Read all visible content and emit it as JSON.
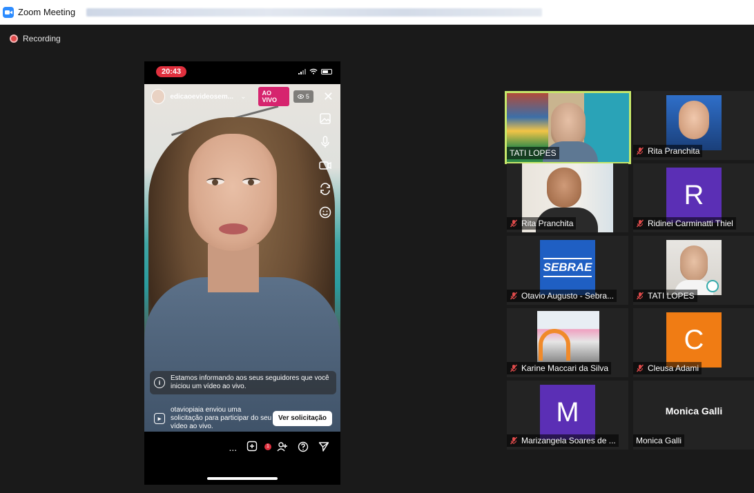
{
  "window": {
    "title": "Zoom Meeting"
  },
  "meeting": {
    "recording_label": "Recording"
  },
  "phone": {
    "time": "20:43",
    "instagram": {
      "username": "edicaoevideosem...",
      "live_badge": "AO VIVO",
      "viewer_count": "5",
      "notice": "Estamos informando aos seus seguidores que você iniciou um vídeo ao vivo.",
      "request_text": "otaviopiaia enviou uma solicitação para participar do seu vídeo ao vivo.",
      "request_button": "Ver solicitação",
      "more_label": "...",
      "request_badge": "1"
    }
  },
  "participants": [
    {
      "name": "TATI LOPES",
      "muted": false,
      "active": true,
      "tile": "video"
    },
    {
      "name": "Rita Pranchita",
      "muted": true,
      "tile": "photo"
    },
    {
      "name": "Rita Pranchita",
      "muted": true,
      "tile": "video"
    },
    {
      "name": "Ridinei Carminatti Thiel",
      "muted": true,
      "tile": "letter",
      "letter": "R",
      "color": "#5b2fb5"
    },
    {
      "name": "Otavio Augusto - Sebra...",
      "muted": true,
      "tile": "logo",
      "logo_text": "SEBRAE",
      "color": "#1f5fc3"
    },
    {
      "name": "TATI LOPES",
      "muted": true,
      "tile": "photo"
    },
    {
      "name": "Karine Maccari da Silva",
      "muted": true,
      "tile": "photo"
    },
    {
      "name": "Cleusa Adami",
      "muted": true,
      "tile": "letter",
      "letter": "C",
      "color": "#f07c14"
    },
    {
      "name": "Marizangela Soares de ...",
      "muted": true,
      "tile": "letter",
      "letter": "M",
      "color": "#5b2fb5"
    },
    {
      "name": "Monica Galli",
      "muted": false,
      "tile": "name",
      "display": "Monica Galli"
    }
  ],
  "colors": {
    "active_speaker": "#c7e86b",
    "muted_icon": "#e04b4b",
    "live_badge": "#d6246e"
  }
}
